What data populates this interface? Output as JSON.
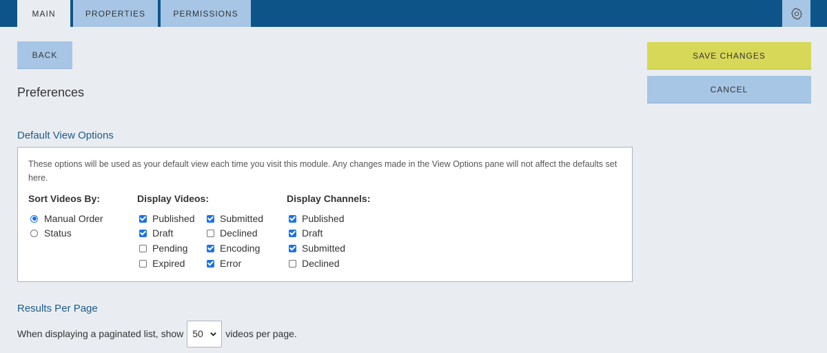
{
  "tabs": [
    {
      "label": "MAIN",
      "active": true
    },
    {
      "label": "PROPERTIES",
      "active": false
    },
    {
      "label": "PERMISSIONS",
      "active": false
    }
  ],
  "settings_icon": "gear-icon",
  "buttons": {
    "back": "BACK",
    "save": "SAVE CHANGES",
    "cancel": "CANCEL"
  },
  "page_title": "Preferences",
  "default_view": {
    "heading": "Default View Options",
    "description": "These options will be used as your default view each time you visit this module. Any changes made in the View Options pane will not affect the defaults set here.",
    "sort": {
      "heading": "Sort Videos By:",
      "options": [
        {
          "label": "Manual Order",
          "selected": true
        },
        {
          "label": "Status",
          "selected": false
        }
      ]
    },
    "display_videos": {
      "heading": "Display Videos:",
      "options": [
        {
          "label": "Published",
          "checked": true
        },
        {
          "label": "Draft",
          "checked": true
        },
        {
          "label": "Pending",
          "checked": false
        },
        {
          "label": "Expired",
          "checked": false
        },
        {
          "label": "Submitted",
          "checked": true
        },
        {
          "label": "Declined",
          "checked": false
        },
        {
          "label": "Encoding",
          "checked": true
        },
        {
          "label": "Error",
          "checked": true
        }
      ]
    },
    "display_channels": {
      "heading": "Display Channels:",
      "options": [
        {
          "label": "Published",
          "checked": true
        },
        {
          "label": "Draft",
          "checked": true
        },
        {
          "label": "Submitted",
          "checked": true
        },
        {
          "label": "Declined",
          "checked": false
        }
      ]
    }
  },
  "results_per_page": {
    "heading": "Results Per Page",
    "prefix": "When displaying a paginated list, show",
    "value": "50",
    "suffix": "videos per page."
  },
  "colors": {
    "topbar": "#0d5588",
    "tab_inactive": "#a7c6e6",
    "save_button": "#d8d858",
    "heading_blue": "#1e5a8a",
    "checkbox_accent": "#1a73e8"
  }
}
